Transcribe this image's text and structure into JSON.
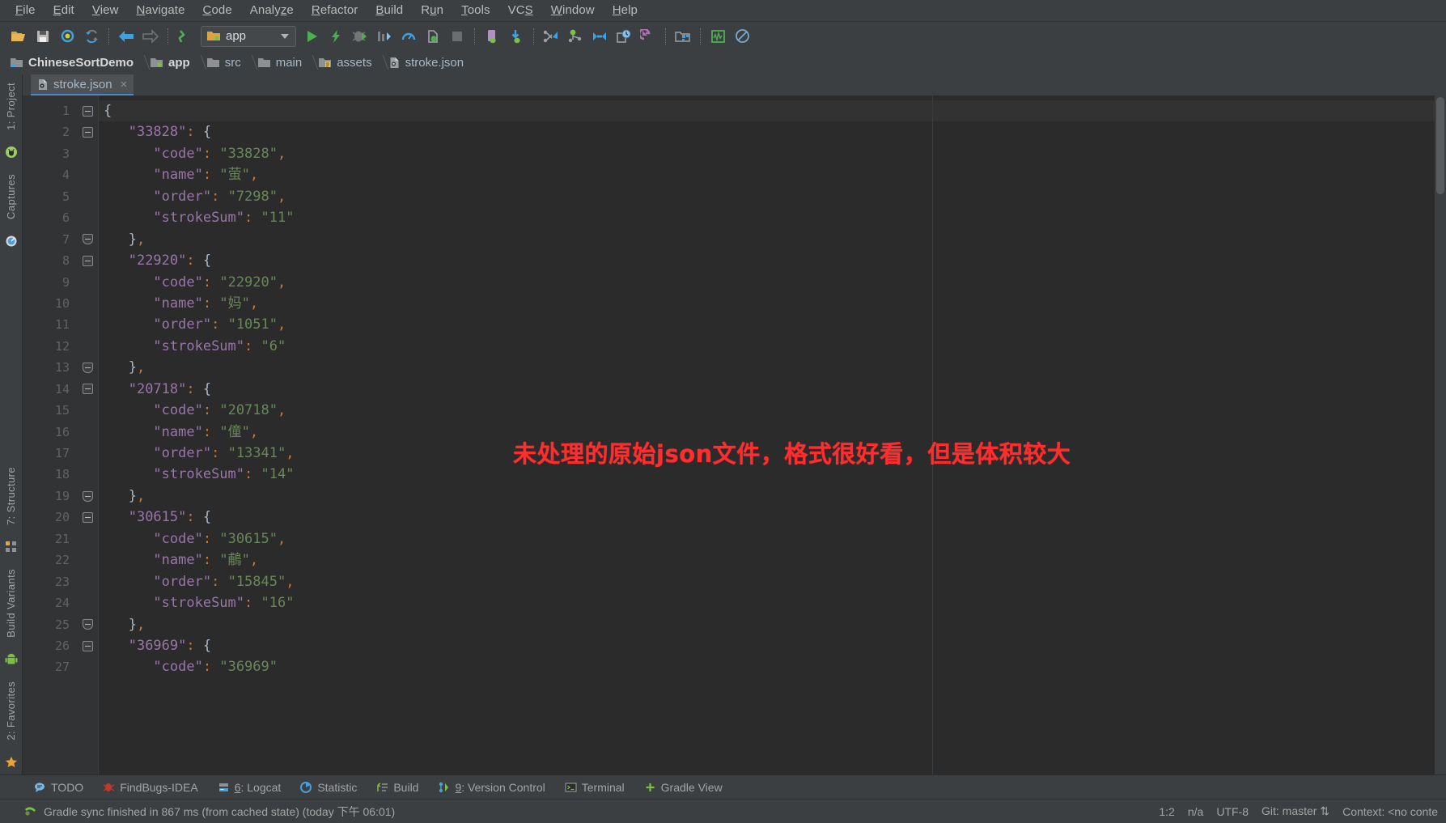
{
  "menubar": {
    "items": [
      {
        "label": "File",
        "mnemonic": "F"
      },
      {
        "label": "Edit",
        "mnemonic": "E"
      },
      {
        "label": "View",
        "mnemonic": "V"
      },
      {
        "label": "Navigate",
        "mnemonic": "N"
      },
      {
        "label": "Code",
        "mnemonic": "C"
      },
      {
        "label": "Analyze",
        "mnemonic": "z"
      },
      {
        "label": "Refactor",
        "mnemonic": "R"
      },
      {
        "label": "Build",
        "mnemonic": "B"
      },
      {
        "label": "Run",
        "mnemonic": "u"
      },
      {
        "label": "Tools",
        "mnemonic": "T"
      },
      {
        "label": "VCS",
        "mnemonic": "S"
      },
      {
        "label": "Window",
        "mnemonic": "W"
      },
      {
        "label": "Help",
        "mnemonic": "H"
      }
    ]
  },
  "toolbar": {
    "run_config": "app",
    "icons": [
      "open-folder-icon",
      "save-all-icon",
      "sync-icon",
      "refresh-icon",
      "navigate-back-icon",
      "navigate-forward-icon",
      "gradle-sync-icon",
      "run-icon",
      "apply-changes-icon",
      "debug-icon",
      "profile-icon",
      "monitor-icon",
      "attach-debugger-icon",
      "stop-icon",
      "avd-manager-icon",
      "sdk-manager-icon",
      "vcs-update-icon",
      "vcs-commit-icon",
      "vcs-push-icon",
      "vcs-history-icon",
      "vcs-revert-icon",
      "layout-inspector-icon",
      "theme-editor-icon",
      "no-access-icon"
    ]
  },
  "breadcrumb": {
    "items": [
      {
        "label": "ChineseSortDemo",
        "icon": "module-icon",
        "bold": true
      },
      {
        "label": "app",
        "icon": "android-module-icon",
        "bold": true
      },
      {
        "label": "src",
        "icon": "folder-icon",
        "bold": false
      },
      {
        "label": "main",
        "icon": "folder-icon",
        "bold": false
      },
      {
        "label": "assets",
        "icon": "assets-folder-icon",
        "bold": false
      },
      {
        "label": "stroke.json",
        "icon": "json-file-icon",
        "bold": false
      }
    ]
  },
  "left_tool_strip": {
    "top": [
      {
        "label": "1: Project",
        "mnemonic": "1",
        "icon": "project-icon"
      },
      {
        "label": "Captures",
        "mnemonic": "",
        "icon": "captures-icon"
      }
    ],
    "bottom": [
      {
        "label": "7: Structure",
        "mnemonic": "7",
        "icon": "structure-icon"
      },
      {
        "label": "Build Variants",
        "mnemonic": "",
        "icon": "android-icon"
      },
      {
        "label": "2: Favorites",
        "mnemonic": "2",
        "icon": "star-icon"
      }
    ]
  },
  "editor": {
    "tab": {
      "label": "stroke.json",
      "icon": "json-file-icon",
      "close": "×"
    },
    "annotation": "未处理的原始json文件，格式很好看，但是体积较大",
    "annotation_color": "#ff2d2d",
    "first_line": 1,
    "lines": [
      {
        "n": 1,
        "indent": 0,
        "tokens": [
          {
            "t": "{",
            "c": "p"
          }
        ],
        "fold": "start",
        "current": true
      },
      {
        "n": 2,
        "indent": 1,
        "tokens": [
          {
            "t": "\"33828\"",
            "c": "k"
          },
          {
            "t": ":",
            "c": "c"
          },
          {
            "t": " ",
            "c": "p"
          },
          {
            "t": "{",
            "c": "p"
          }
        ],
        "fold": "start"
      },
      {
        "n": 3,
        "indent": 2,
        "tokens": [
          {
            "t": "\"code\"",
            "c": "k"
          },
          {
            "t": ":",
            "c": "c"
          },
          {
            "t": " ",
            "c": "p"
          },
          {
            "t": "\"33828\"",
            "c": "s"
          },
          {
            "t": ",",
            "c": "c"
          }
        ]
      },
      {
        "n": 4,
        "indent": 2,
        "tokens": [
          {
            "t": "\"name\"",
            "c": "k"
          },
          {
            "t": ":",
            "c": "c"
          },
          {
            "t": " ",
            "c": "p"
          },
          {
            "t": "\"萤\"",
            "c": "s"
          },
          {
            "t": ",",
            "c": "c"
          }
        ]
      },
      {
        "n": 5,
        "indent": 2,
        "tokens": [
          {
            "t": "\"order\"",
            "c": "k"
          },
          {
            "t": ":",
            "c": "c"
          },
          {
            "t": " ",
            "c": "p"
          },
          {
            "t": "\"7298\"",
            "c": "s"
          },
          {
            "t": ",",
            "c": "c"
          }
        ]
      },
      {
        "n": 6,
        "indent": 2,
        "tokens": [
          {
            "t": "\"strokeSum\"",
            "c": "k"
          },
          {
            "t": ":",
            "c": "c"
          },
          {
            "t": " ",
            "c": "p"
          },
          {
            "t": "\"11\"",
            "c": "s"
          }
        ]
      },
      {
        "n": 7,
        "indent": 1,
        "tokens": [
          {
            "t": "}",
            "c": "p"
          },
          {
            "t": ",",
            "c": "c"
          }
        ],
        "fold": "end"
      },
      {
        "n": 8,
        "indent": 1,
        "tokens": [
          {
            "t": "\"22920\"",
            "c": "k"
          },
          {
            "t": ":",
            "c": "c"
          },
          {
            "t": " ",
            "c": "p"
          },
          {
            "t": "{",
            "c": "p"
          }
        ],
        "fold": "start"
      },
      {
        "n": 9,
        "indent": 2,
        "tokens": [
          {
            "t": "\"code\"",
            "c": "k"
          },
          {
            "t": ":",
            "c": "c"
          },
          {
            "t": " ",
            "c": "p"
          },
          {
            "t": "\"22920\"",
            "c": "s"
          },
          {
            "t": ",",
            "c": "c"
          }
        ]
      },
      {
        "n": 10,
        "indent": 2,
        "tokens": [
          {
            "t": "\"name\"",
            "c": "k"
          },
          {
            "t": ":",
            "c": "c"
          },
          {
            "t": " ",
            "c": "p"
          },
          {
            "t": "\"妈\"",
            "c": "s"
          },
          {
            "t": ",",
            "c": "c"
          }
        ]
      },
      {
        "n": 11,
        "indent": 2,
        "tokens": [
          {
            "t": "\"order\"",
            "c": "k"
          },
          {
            "t": ":",
            "c": "c"
          },
          {
            "t": " ",
            "c": "p"
          },
          {
            "t": "\"1051\"",
            "c": "s"
          },
          {
            "t": ",",
            "c": "c"
          }
        ]
      },
      {
        "n": 12,
        "indent": 2,
        "tokens": [
          {
            "t": "\"strokeSum\"",
            "c": "k"
          },
          {
            "t": ":",
            "c": "c"
          },
          {
            "t": " ",
            "c": "p"
          },
          {
            "t": "\"6\"",
            "c": "s"
          }
        ]
      },
      {
        "n": 13,
        "indent": 1,
        "tokens": [
          {
            "t": "}",
            "c": "p"
          },
          {
            "t": ",",
            "c": "c"
          }
        ],
        "fold": "end"
      },
      {
        "n": 14,
        "indent": 1,
        "tokens": [
          {
            "t": "\"20718\"",
            "c": "k"
          },
          {
            "t": ":",
            "c": "c"
          },
          {
            "t": " ",
            "c": "p"
          },
          {
            "t": "{",
            "c": "p"
          }
        ],
        "fold": "start"
      },
      {
        "n": 15,
        "indent": 2,
        "tokens": [
          {
            "t": "\"code\"",
            "c": "k"
          },
          {
            "t": ":",
            "c": "c"
          },
          {
            "t": " ",
            "c": "p"
          },
          {
            "t": "\"20718\"",
            "c": "s"
          },
          {
            "t": ",",
            "c": "c"
          }
        ]
      },
      {
        "n": 16,
        "indent": 2,
        "tokens": [
          {
            "t": "\"name\"",
            "c": "k"
          },
          {
            "t": ":",
            "c": "c"
          },
          {
            "t": " ",
            "c": "p"
          },
          {
            "t": "\"僮\"",
            "c": "s"
          },
          {
            "t": ",",
            "c": "c"
          }
        ]
      },
      {
        "n": 17,
        "indent": 2,
        "tokens": [
          {
            "t": "\"order\"",
            "c": "k"
          },
          {
            "t": ":",
            "c": "c"
          },
          {
            "t": " ",
            "c": "p"
          },
          {
            "t": "\"13341\"",
            "c": "s"
          },
          {
            "t": ",",
            "c": "c"
          }
        ]
      },
      {
        "n": 18,
        "indent": 2,
        "tokens": [
          {
            "t": "\"strokeSum\"",
            "c": "k"
          },
          {
            "t": ":",
            "c": "c"
          },
          {
            "t": " ",
            "c": "p"
          },
          {
            "t": "\"14\"",
            "c": "s"
          }
        ]
      },
      {
        "n": 19,
        "indent": 1,
        "tokens": [
          {
            "t": "}",
            "c": "p"
          },
          {
            "t": ",",
            "c": "c"
          }
        ],
        "fold": "end"
      },
      {
        "n": 20,
        "indent": 1,
        "tokens": [
          {
            "t": "\"30615\"",
            "c": "k"
          },
          {
            "t": ":",
            "c": "c"
          },
          {
            "t": " ",
            "c": "p"
          },
          {
            "t": "{",
            "c": "p"
          }
        ],
        "fold": "start"
      },
      {
        "n": 21,
        "indent": 2,
        "tokens": [
          {
            "t": "\"code\"",
            "c": "k"
          },
          {
            "t": ":",
            "c": "c"
          },
          {
            "t": " ",
            "c": "p"
          },
          {
            "t": "\"30615\"",
            "c": "s"
          },
          {
            "t": ",",
            "c": "c"
          }
        ]
      },
      {
        "n": 22,
        "indent": 2,
        "tokens": [
          {
            "t": "\"name\"",
            "c": "k"
          },
          {
            "t": ":",
            "c": "c"
          },
          {
            "t": " ",
            "c": "p"
          },
          {
            "t": "\"鵏\"",
            "c": "s"
          },
          {
            "t": ",",
            "c": "c"
          }
        ]
      },
      {
        "n": 23,
        "indent": 2,
        "tokens": [
          {
            "t": "\"order\"",
            "c": "k"
          },
          {
            "t": ":",
            "c": "c"
          },
          {
            "t": " ",
            "c": "p"
          },
          {
            "t": "\"15845\"",
            "c": "s"
          },
          {
            "t": ",",
            "c": "c"
          }
        ]
      },
      {
        "n": 24,
        "indent": 2,
        "tokens": [
          {
            "t": "\"strokeSum\"",
            "c": "k"
          },
          {
            "t": ":",
            "c": "c"
          },
          {
            "t": " ",
            "c": "p"
          },
          {
            "t": "\"16\"",
            "c": "s"
          }
        ]
      },
      {
        "n": 25,
        "indent": 1,
        "tokens": [
          {
            "t": "}",
            "c": "p"
          },
          {
            "t": ",",
            "c": "c"
          }
        ],
        "fold": "end"
      },
      {
        "n": 26,
        "indent": 1,
        "tokens": [
          {
            "t": "\"36969\"",
            "c": "k"
          },
          {
            "t": ":",
            "c": "c"
          },
          {
            "t": " ",
            "c": "p"
          },
          {
            "t": "{",
            "c": "p"
          }
        ],
        "fold": "start"
      },
      {
        "n": 27,
        "indent": 2,
        "tokens": [
          {
            "t": "\"code\"",
            "c": "k"
          },
          {
            "t": ":",
            "c": "c"
          },
          {
            "t": " ",
            "c": "p"
          },
          {
            "t": "\"36969\"",
            "c": "s"
          }
        ]
      }
    ]
  },
  "bottom_bar": {
    "tabs": [
      {
        "label": "TODO",
        "mnemonic": "",
        "icon": "todo-icon"
      },
      {
        "label": "FindBugs-IDEA",
        "mnemonic": "",
        "icon": "findbugs-icon"
      },
      {
        "label": "6: Logcat",
        "mnemonic": "6",
        "icon": "logcat-icon"
      },
      {
        "label": "Statistic",
        "mnemonic": "",
        "icon": "statistic-icon"
      },
      {
        "label": "Build",
        "mnemonic": "",
        "icon": "build-icon"
      },
      {
        "label": "9: Version Control",
        "mnemonic": "9",
        "icon": "version-control-icon"
      },
      {
        "label": "Terminal",
        "mnemonic": "",
        "icon": "terminal-icon"
      },
      {
        "label": "Gradle View",
        "mnemonic": "",
        "icon": "plus-icon"
      }
    ]
  },
  "statusbar": {
    "message": "Gradle sync finished in 867 ms (from cached state) (today 下午 06:01)",
    "caret": "1:2",
    "line_sep": "n/a",
    "encoding": "UTF-8",
    "git_branch": "Git: master",
    "context": "Context: <no conte"
  }
}
